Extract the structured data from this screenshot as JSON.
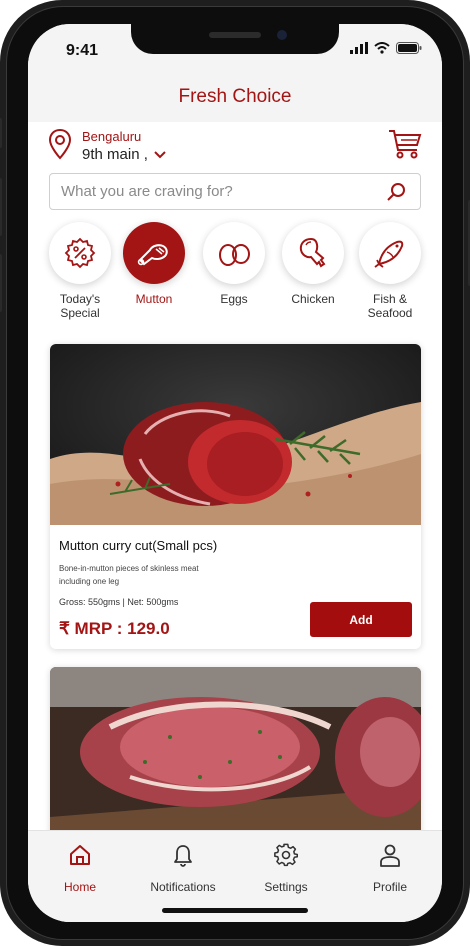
{
  "status": {
    "time": "9:41"
  },
  "header": {
    "title": "Fresh Choice"
  },
  "location": {
    "city": "Bengaluru",
    "area": "9th main ,"
  },
  "search": {
    "placeholder": "What you are craving for?"
  },
  "categories": [
    {
      "label": "Today's Special",
      "icon": "discount-badge-icon",
      "active": false
    },
    {
      "label": "Mutton",
      "icon": "mutton-leg-icon",
      "active": true
    },
    {
      "label": "Eggs",
      "icon": "eggs-icon",
      "active": false
    },
    {
      "label": "Chicken",
      "icon": "chicken-leg-icon",
      "active": false
    },
    {
      "label": "Fish & Seafood",
      "icon": "fish-icon",
      "active": false
    }
  ],
  "products": [
    {
      "name": "Mutton curry cut(Small pcs)",
      "description": "Bone-in-mutton pieces of skinless meat including one leg",
      "weight": "Gross: 550gms | Net: 500gms",
      "price": "₹  MRP : 129.0",
      "add_label": "Add"
    }
  ],
  "nav": [
    {
      "label": "Home",
      "icon": "home-icon",
      "active": true
    },
    {
      "label": "Notifications",
      "icon": "bell-icon",
      "active": false
    },
    {
      "label": "Settings",
      "icon": "gear-icon",
      "active": false
    },
    {
      "label": "Profile",
      "icon": "person-icon",
      "active": false
    }
  ],
  "colors": {
    "accent": "#a31515",
    "button": "#a30d0d",
    "background": "#f4f4f4"
  }
}
